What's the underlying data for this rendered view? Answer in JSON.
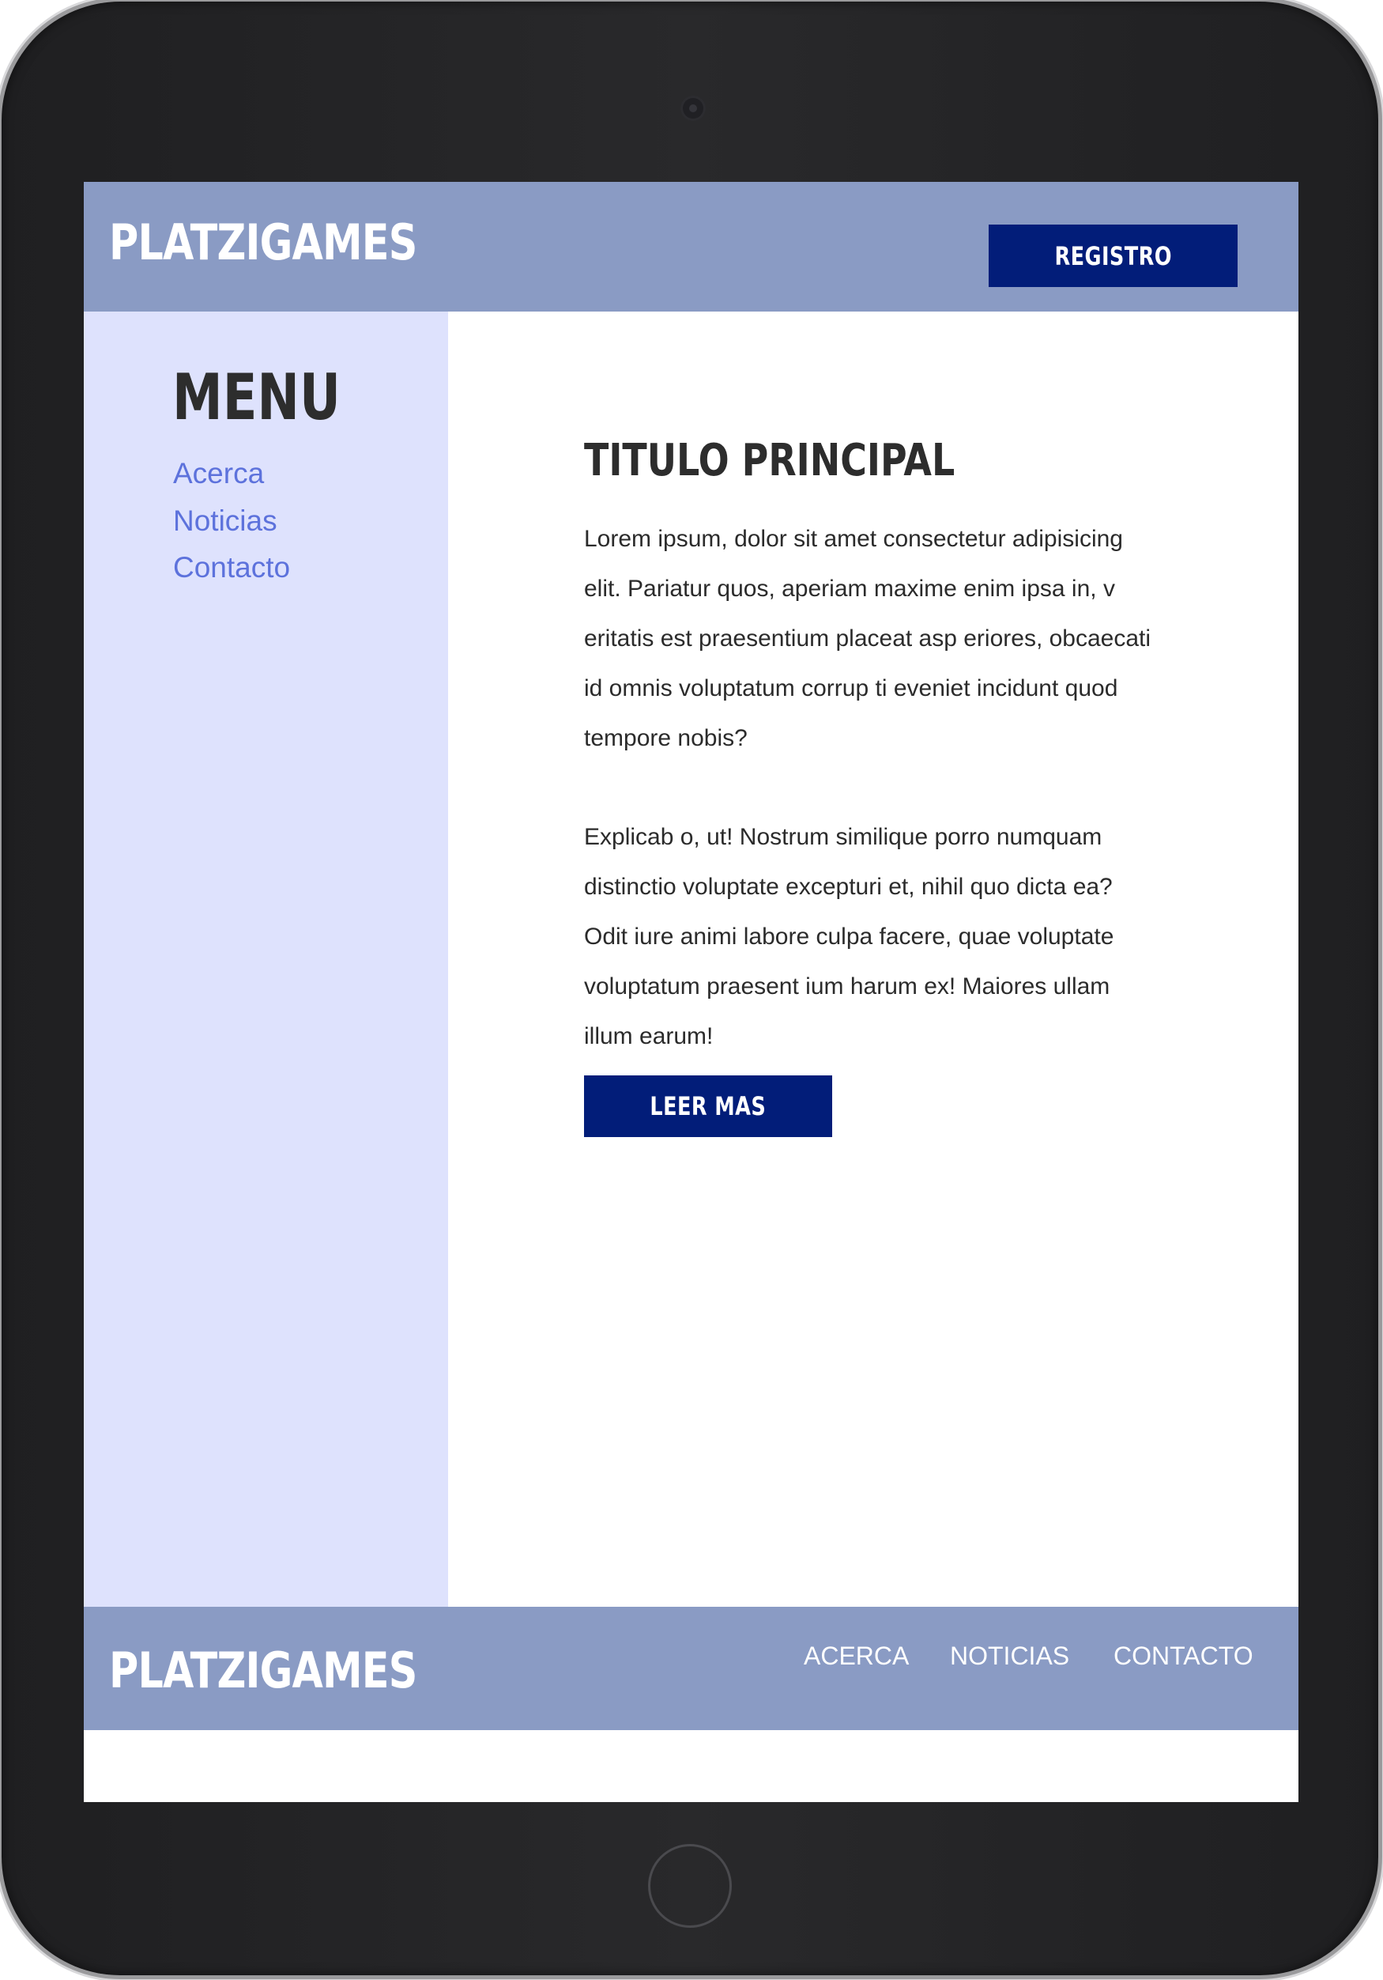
{
  "header": {
    "logo": "PLATZIGAMES",
    "register_label": "REGISTRO"
  },
  "sidebar": {
    "title": "MENU",
    "items": [
      {
        "label": "Acerca"
      },
      {
        "label": "Noticias"
      },
      {
        "label": "Contacto"
      }
    ]
  },
  "main": {
    "title": "TITULO PRINCIPAL",
    "paragraphs": [
      "Lorem ipsum, dolor sit amet consectetur adipisicing elit. Pariatur quos, aperiam maxime enim ipsa in, v eritatis est praesentium placeat asp eriores, obcaecati id omnis voluptatum corrup ti eveniet incidunt quod tempore nobis?",
      "Explicab o, ut! Nostrum similique porro numquam distinctio voluptate excepturi et, nihil quo dicta ea? Odit iure animi labore culpa facere, quae voluptate voluptatum praesent ium harum ex! Maiores ullam illum earum!"
    ],
    "read_more_label": "LEER MAS"
  },
  "footer": {
    "logo": "PLATZIGAMES",
    "links": [
      {
        "label": "ACERCA"
      },
      {
        "label": "NOTICIAS"
      },
      {
        "label": "CONTACTO"
      }
    ]
  },
  "colors": {
    "header_bg": "#8a9bc4",
    "sidebar_bg": "#dee2fd",
    "button_bg": "#021d79",
    "link_color": "#5d72dc",
    "device_frame": "#232325"
  }
}
